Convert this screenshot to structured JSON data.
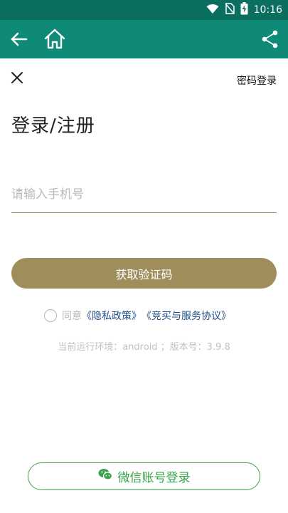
{
  "status_bar": {
    "time": "10:16"
  },
  "header": {
    "back_icon": "back-arrow-icon",
    "home_icon": "home-icon",
    "share_icon": "share-icon",
    "bg_color": "#0e8a76"
  },
  "top": {
    "close_icon": "close-icon",
    "password_login": "密码登录"
  },
  "form": {
    "title": "登录/注册",
    "phone_placeholder": "请输入手机号",
    "get_code_button": "获取验证码",
    "button_color": "#a08d5c"
  },
  "agreement": {
    "agree_text": "同意",
    "privacy_policy": "《隐私政策》",
    "service_agreement": "《竞买与服务协议》"
  },
  "version_info": "当前运行环境：android ；版本号：3.9.8",
  "wechat": {
    "icon": "wechat-icon",
    "label": "微信账号登录",
    "color": "#3aa24a"
  }
}
